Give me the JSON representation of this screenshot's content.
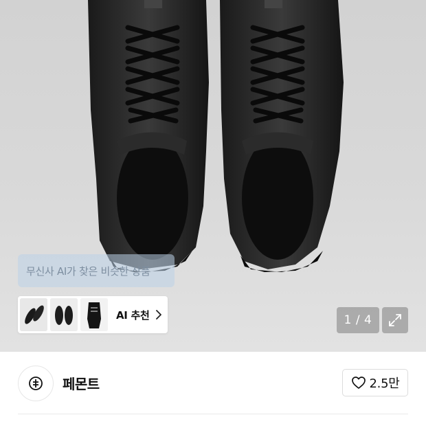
{
  "gallery": {
    "ai_tooltip_text": "무신사 AI가 찾은 비슷한 상품",
    "ai_recommend_label": "AI 추천",
    "page_counter": "1 / 4",
    "icons": {
      "expand": "expand-arrows-icon",
      "chevron": "chevron-right-icon"
    }
  },
  "brand": {
    "name": "페몬트",
    "logo_icon": "brand-logo-icon",
    "like_count": "2.5만",
    "like_icon": "heart-icon"
  },
  "colors": {
    "hero_bg": "#d9d9d9",
    "overlay_bg": "#969696",
    "tooltip_bg": "#bcd2e8",
    "text": "#111111"
  }
}
